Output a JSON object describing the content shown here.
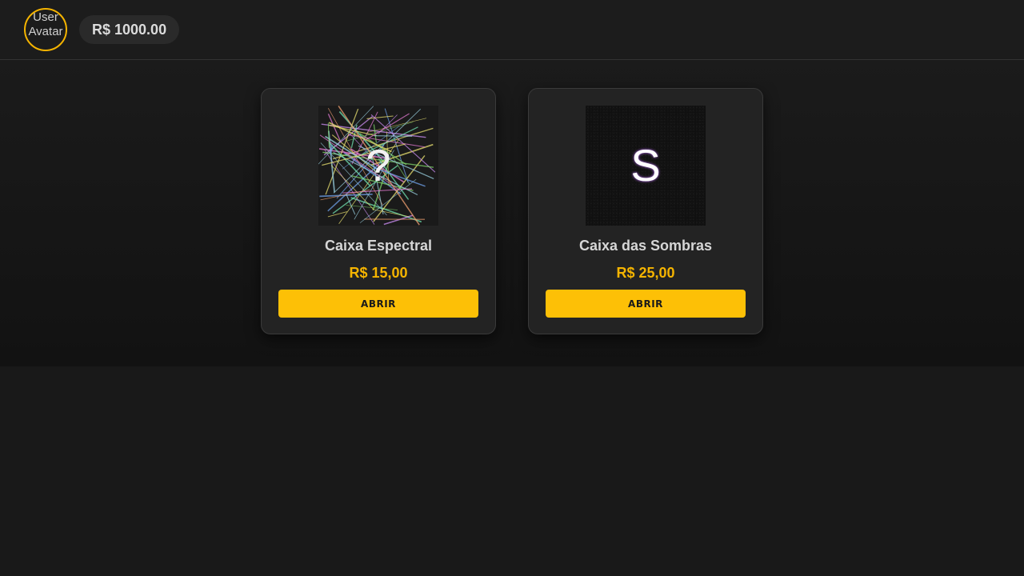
{
  "header": {
    "avatar_alt": "User Avatar",
    "balance": "R$ 1000.00"
  },
  "colors": {
    "accent": "#fdc006",
    "price": "#f5b400",
    "background": "#191919"
  },
  "cases": [
    {
      "name": "Caixa Espectral",
      "price": "R$ 15,00",
      "button": "ABRIR",
      "glyph": "?",
      "image": "colored-lines"
    },
    {
      "name": "Caixa das Sombras",
      "price": "R$ 25,00",
      "button": "ABRIR",
      "glyph": "S",
      "image": "dark-noise"
    }
  ]
}
